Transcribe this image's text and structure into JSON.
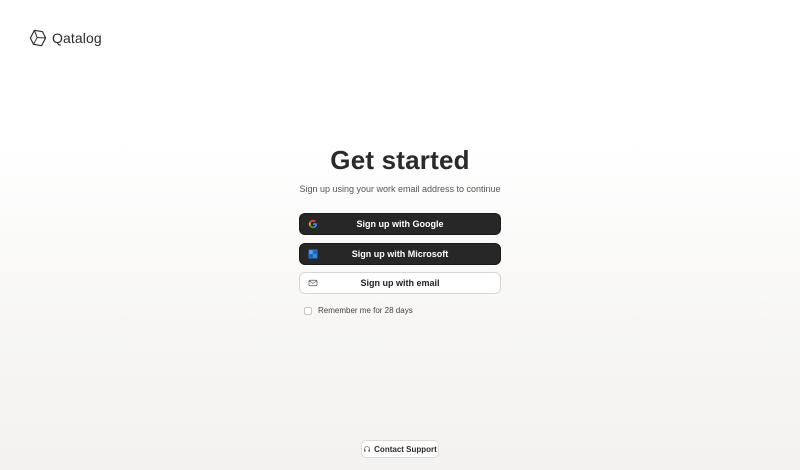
{
  "brand": {
    "name": "Qatalog",
    "icon": "hexagon-logo-icon"
  },
  "heading": "Get started",
  "subheading": "Sign up using your work email address to continue",
  "buttons": {
    "google": {
      "label": "Sign up with Google",
      "icon": "google-icon"
    },
    "microsoft": {
      "label": "Sign up with Microsoft",
      "icon": "microsoft-icon"
    },
    "email": {
      "label": "Sign up with email",
      "icon": "envelope-icon"
    }
  },
  "remember": {
    "label": "Remember me for 28 days",
    "checked": false
  },
  "support": {
    "label": "Contact Support",
    "icon": "headset-icon"
  },
  "colors": {
    "dark_button": "#272727",
    "background_bottom": "#f3f2f0",
    "text": "#2a2a2a"
  }
}
